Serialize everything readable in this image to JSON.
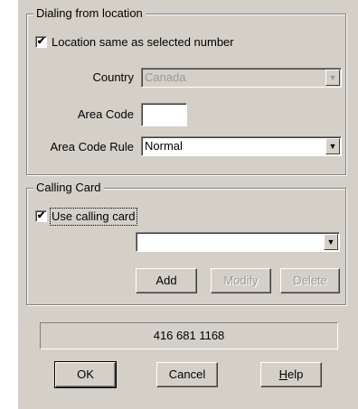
{
  "dialing": {
    "legend": "Dialing from location",
    "same_location_label": "Location same as selected number",
    "same_location_checked": true,
    "country_label": "Country",
    "country_value": "Canada",
    "area_code_label": "Area Code",
    "area_code_value": "",
    "area_code_rule_label": "Area Code Rule",
    "area_code_rule_value": "Normal"
  },
  "calling_card": {
    "legend": "Calling Card",
    "use_card_label": "Use calling card",
    "use_card_checked": true,
    "card_value": "",
    "add_label": "Add",
    "modify_label": "Modify",
    "delete_label": "Delete"
  },
  "status": {
    "number": "416 681 1168"
  },
  "footer": {
    "ok_label": "OK",
    "cancel_label": "Cancel",
    "help_label_prefix": "",
    "help_label_mnemonic": "H",
    "help_label_rest": "elp"
  },
  "icons": {
    "check": "✔",
    "dropdown": "▼"
  }
}
